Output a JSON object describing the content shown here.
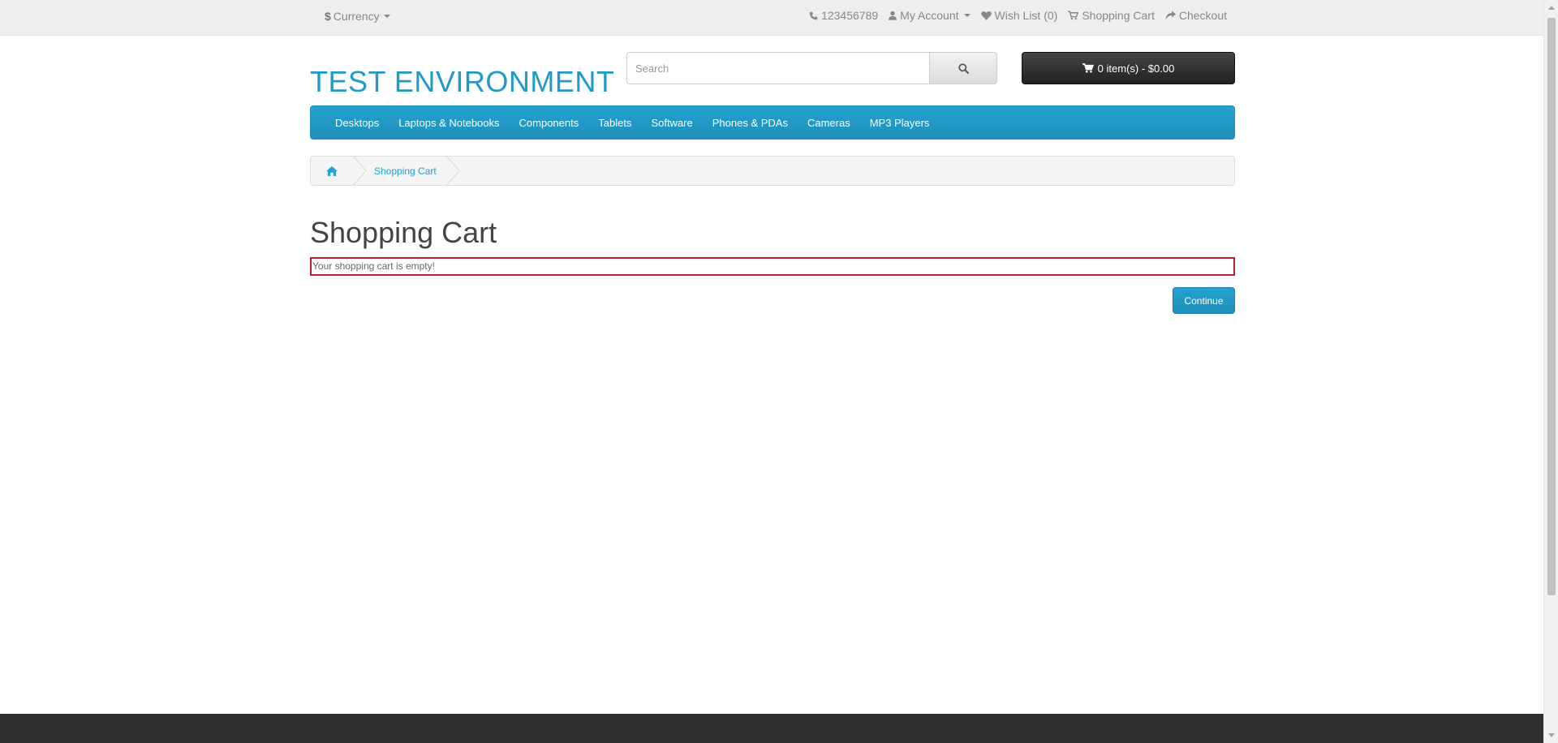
{
  "topbar": {
    "currency_symbol": "$",
    "currency_label": "Currency",
    "phone": "123456789",
    "my_account": "My Account",
    "wishlist": "Wish List (0)",
    "shopping_cart": "Shopping Cart",
    "checkout": "Checkout"
  },
  "header": {
    "logo": "TEST ENVIRONMENT",
    "search_placeholder": "Search",
    "cart_summary": "0 item(s) - $0.00"
  },
  "menu": {
    "items": [
      "Desktops",
      "Laptops & Notebooks",
      "Components",
      "Tablets",
      "Software",
      "Phones & PDAs",
      "Cameras",
      "MP3 Players"
    ]
  },
  "breadcrumb": {
    "current": "Shopping Cart"
  },
  "main": {
    "title": "Shopping Cart",
    "empty_message": "Your shopping cart is empty!",
    "continue_label": "Continue"
  },
  "colors": {
    "accent": "#229ac8",
    "error_border": "#b0252b",
    "footer": "#303030"
  }
}
